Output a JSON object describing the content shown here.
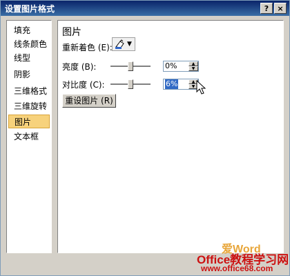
{
  "window": {
    "title": "设置图片格式",
    "help_label": "?",
    "close_label": "×"
  },
  "sidebar": {
    "items": [
      {
        "label": "填充"
      },
      {
        "label": "线条颜色"
      },
      {
        "label": "线型"
      },
      {
        "label": "阴影"
      },
      {
        "label": "三维格式"
      },
      {
        "label": "三维旋转"
      },
      {
        "label": "图片"
      },
      {
        "label": "文本框"
      }
    ],
    "selected": "图片"
  },
  "panel": {
    "title": "图片",
    "recolor": {
      "label": "重新着色 (E):",
      "arrow": "▼",
      "icon": "picture-recolor-icon"
    },
    "brightness": {
      "label": "亮度 (B):",
      "value": "0%",
      "slider_level": 0.5
    },
    "contrast": {
      "label": "对比度 (C):",
      "value": "6%",
      "slider_level": 0.5
    },
    "reset_button": "重设图片 (R)"
  },
  "watermark": {
    "line1": "爱Word",
    "line2": "Office教程学习网",
    "line3": "www.office68.com"
  }
}
